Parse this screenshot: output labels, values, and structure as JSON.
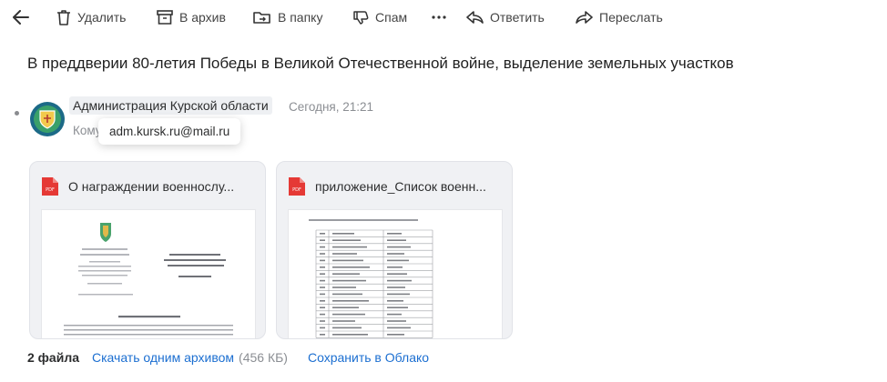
{
  "toolbar": {
    "delete_label": "Удалить",
    "archive_label": "В архив",
    "folder_label": "В папку",
    "spam_label": "Спам",
    "reply_label": "Ответить",
    "forward_label": "Переслать"
  },
  "message": {
    "subject": "В преддверии 80-летия Победы в Великой Отечественной войне, выделение земельных участков",
    "sender_name": "Администрация Курской области",
    "date": "Сегодня, 21:21",
    "to_label": "Кому",
    "sender_email": "adm.kursk.ru@mail.ru"
  },
  "attachments": [
    {
      "name": "О награждении военнослу...",
      "icon": "pdf-icon"
    },
    {
      "name": "приложение_Список военн...",
      "icon": "pdf-icon"
    }
  ],
  "footer": {
    "count": "2 файла",
    "download_label": "Скачать одним архивом",
    "size": "(456 КБ)",
    "save_cloud_label": "Сохранить в Облако"
  },
  "colors": {
    "link": "#1c6fd1",
    "pdf_red": "#e53935",
    "muted": "#8b8e93"
  }
}
